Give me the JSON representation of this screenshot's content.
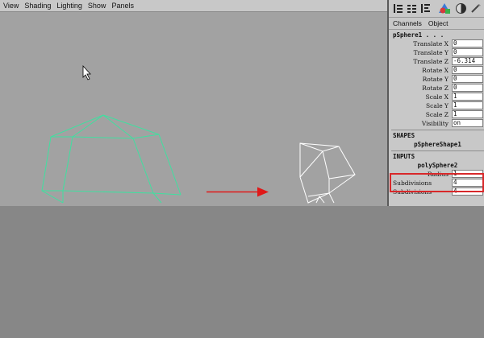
{
  "viewport": {
    "menu": [
      "View",
      "Shading",
      "Lighting",
      "Show",
      "Panels"
    ]
  },
  "scene": {
    "arrow_color": "#e01818",
    "selected_wire_color": "#3fe0a0",
    "other_wire_color": "#ffffff"
  },
  "channel_box": {
    "tabs": [
      "Channels",
      "Object"
    ],
    "object_name": "pSphere1 . . .",
    "attributes": [
      {
        "label": "Translate X",
        "value": "0"
      },
      {
        "label": "Translate Y",
        "value": "0"
      },
      {
        "label": "Translate Z",
        "value": "-6.314"
      },
      {
        "label": "Rotate X",
        "value": "0"
      },
      {
        "label": "Rotate Y",
        "value": "0"
      },
      {
        "label": "Rotate Z",
        "value": "0"
      },
      {
        "label": "Scale X",
        "value": "1"
      },
      {
        "label": "Scale Y",
        "value": "1"
      },
      {
        "label": "Scale Z",
        "value": "1"
      },
      {
        "label": "Visibility",
        "value": "on"
      }
    ],
    "shapes_header": "SHAPES",
    "shape_name": "pSphereShape1",
    "inputs_header": "INPUTS",
    "input_name": "polySphere2",
    "input_attributes": [
      {
        "label": "Radius",
        "value": "1"
      },
      {
        "label": "Subdivisions",
        "value": "4"
      },
      {
        "label": "Subdivisions",
        "value": "4"
      }
    ],
    "highlight_color": "#d8282a"
  }
}
